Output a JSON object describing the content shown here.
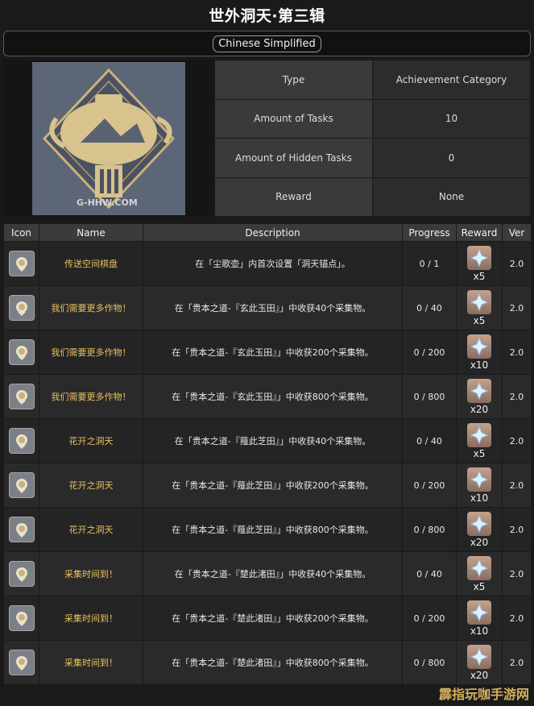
{
  "header": {
    "title": "世外洞天·第三辑"
  },
  "language": {
    "label": "Chinese Simplified"
  },
  "image": {
    "watermark": "G-HHW.COM"
  },
  "info": [
    {
      "key": "Type",
      "value": "Achievement Category"
    },
    {
      "key": "Amount of Tasks",
      "value": "10"
    },
    {
      "key": "Amount of Hidden Tasks",
      "value": "0"
    },
    {
      "key": "Reward",
      "value": "None"
    }
  ],
  "table": {
    "headers": {
      "icon": "Icon",
      "name": "Name",
      "description": "Description",
      "progress": "Progress",
      "reward": "Reward",
      "ver": "Ver"
    },
    "rows": [
      {
        "name": "传送空间棋盘",
        "description": "在「尘歌壶」内首次设置「洞天锚点」。",
        "progress": "0 / 1",
        "reward": "x5",
        "ver": "2.0"
      },
      {
        "name": "我们需要更多作物！",
        "description": "在「贵本之道-『玄此玉田』」中收获40个采集物。",
        "progress": "0 / 40",
        "reward": "x5",
        "ver": "2.0"
      },
      {
        "name": "我们需要更多作物！",
        "description": "在「贵本之道-『玄此玉田』」中收获200个采集物。",
        "progress": "0 / 200",
        "reward": "x10",
        "ver": "2.0"
      },
      {
        "name": "我们需要更多作物！",
        "description": "在「贵本之道-『玄此玉田』」中收获800个采集物。",
        "progress": "0 / 800",
        "reward": "x20",
        "ver": "2.0"
      },
      {
        "name": "花开之洞天",
        "description": "在「贵本之道-『薤此芝田』」中收获40个采集物。",
        "progress": "0 / 40",
        "reward": "x5",
        "ver": "2.0"
      },
      {
        "name": "花开之洞天",
        "description": "在「贵本之道-『薤此芝田』」中收获200个采集物。",
        "progress": "0 / 200",
        "reward": "x10",
        "ver": "2.0"
      },
      {
        "name": "花开之洞天",
        "description": "在「贵本之道-『薤此芝田』」中收获800个采集物。",
        "progress": "0 / 800",
        "reward": "x20",
        "ver": "2.0"
      },
      {
        "name": "采集时间到！",
        "description": "在「贵本之道-『楚此渚田』」中收获40个采集物。",
        "progress": "0 / 40",
        "reward": "x5",
        "ver": "2.0"
      },
      {
        "name": "采集时间到！",
        "description": "在「贵本之道-『楚此渚田』」中收获200个采集物。",
        "progress": "0 / 200",
        "reward": "x10",
        "ver": "2.0"
      },
      {
        "name": "采集时间到！",
        "description": "在「贵本之道-『楚此渚田』」中收获800个采集物。",
        "progress": "0 / 800",
        "reward": "x20",
        "ver": "2.0"
      }
    ]
  },
  "icons": {
    "achievement": "achievement-medal-icon",
    "reward": "primogem-icon"
  },
  "site": {
    "watermark": "霹指玩咖手游网"
  },
  "colors": {
    "accent": "#e8c160",
    "background": "#1a1a1a",
    "header": "#3b3b3b"
  }
}
